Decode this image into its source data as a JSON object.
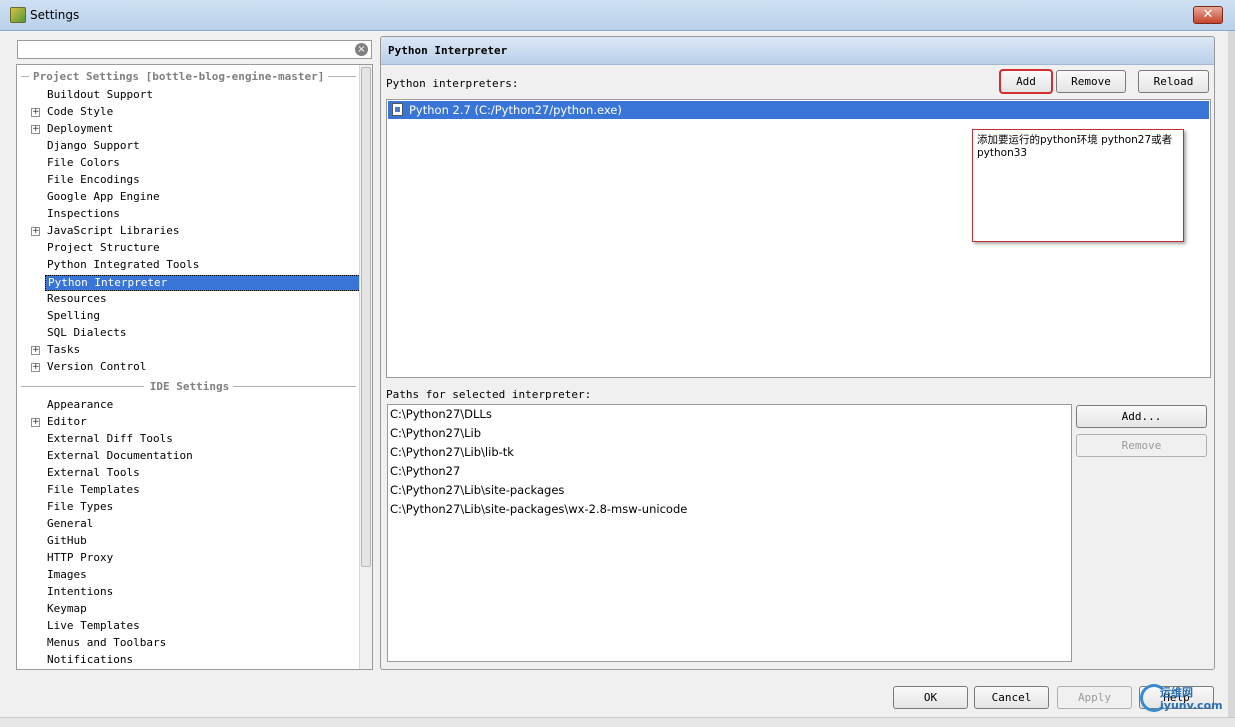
{
  "window": {
    "title": "Settings",
    "close_label": "✕"
  },
  "search": {
    "value": "",
    "placeholder": ""
  },
  "tree": {
    "project_header": "Project Settings [bottle-blog-engine-master]",
    "project_items": [
      {
        "label": "Buildout Support",
        "expandable": false
      },
      {
        "label": "Code Style",
        "expandable": true
      },
      {
        "label": "Deployment",
        "expandable": true
      },
      {
        "label": "Django Support",
        "expandable": false
      },
      {
        "label": "File Colors",
        "expandable": false
      },
      {
        "label": "File Encodings",
        "expandable": false
      },
      {
        "label": "Google App Engine",
        "expandable": false
      },
      {
        "label": "Inspections",
        "expandable": false
      },
      {
        "label": "JavaScript Libraries",
        "expandable": true
      },
      {
        "label": "Project Structure",
        "expandable": false
      },
      {
        "label": "Python Integrated Tools",
        "expandable": false
      },
      {
        "label": "Python Interpreter",
        "expandable": false,
        "selected": true
      },
      {
        "label": "Resources",
        "expandable": false
      },
      {
        "label": "Spelling",
        "expandable": false
      },
      {
        "label": "SQL Dialects",
        "expandable": false
      },
      {
        "label": "Tasks",
        "expandable": true
      },
      {
        "label": "Version Control",
        "expandable": true
      }
    ],
    "ide_header": "IDE Settings",
    "ide_items": [
      {
        "label": "Appearance",
        "expandable": false
      },
      {
        "label": "Editor",
        "expandable": true
      },
      {
        "label": "External Diff Tools",
        "expandable": false
      },
      {
        "label": "External Documentation",
        "expandable": false
      },
      {
        "label": "External Tools",
        "expandable": false
      },
      {
        "label": "File Templates",
        "expandable": false
      },
      {
        "label": "File Types",
        "expandable": false
      },
      {
        "label": "General",
        "expandable": false
      },
      {
        "label": "GitHub",
        "expandable": false
      },
      {
        "label": "HTTP Proxy",
        "expandable": false
      },
      {
        "label": "Images",
        "expandable": false
      },
      {
        "label": "Intentions",
        "expandable": false
      },
      {
        "label": "Keymap",
        "expandable": false
      },
      {
        "label": "Live Templates",
        "expandable": false
      },
      {
        "label": "Menus and Toolbars",
        "expandable": false
      },
      {
        "label": "Notifications",
        "expandable": false
      }
    ]
  },
  "panel": {
    "title": "Python Interpreter",
    "interpreters_label": "Python interpreters:",
    "add_label": "Add",
    "remove_label": "Remove",
    "reload_label": "Reload",
    "interpreters": [
      "Python 2.7 (C:/Python27/python.exe)"
    ],
    "annotation": "添加要运行的python环境 python27或者python33",
    "paths_label": "Paths for selected interpreter:",
    "paths": [
      "C:\\Python27\\DLLs",
      "C:\\Python27\\Lib",
      "C:\\Python27\\Lib\\lib-tk",
      "C:\\Python27",
      "C:\\Python27\\Lib\\site-packages",
      "C:\\Python27\\Lib\\site-packages\\wx-2.8-msw-unicode"
    ],
    "paths_add_label": "Add...",
    "paths_remove_label": "Remove"
  },
  "footer": {
    "ok_label": "OK",
    "cancel_label": "Cancel",
    "apply_label": "Apply",
    "help_label": "Help",
    "watermark_line1": "运维网",
    "watermark_line2": "iyunv.com"
  },
  "colors": {
    "selection": "#3875d7",
    "highlight_border": "#d03030",
    "header_gradient_top": "#dbe7f5",
    "header_gradient_bottom": "#b9d0ea"
  }
}
